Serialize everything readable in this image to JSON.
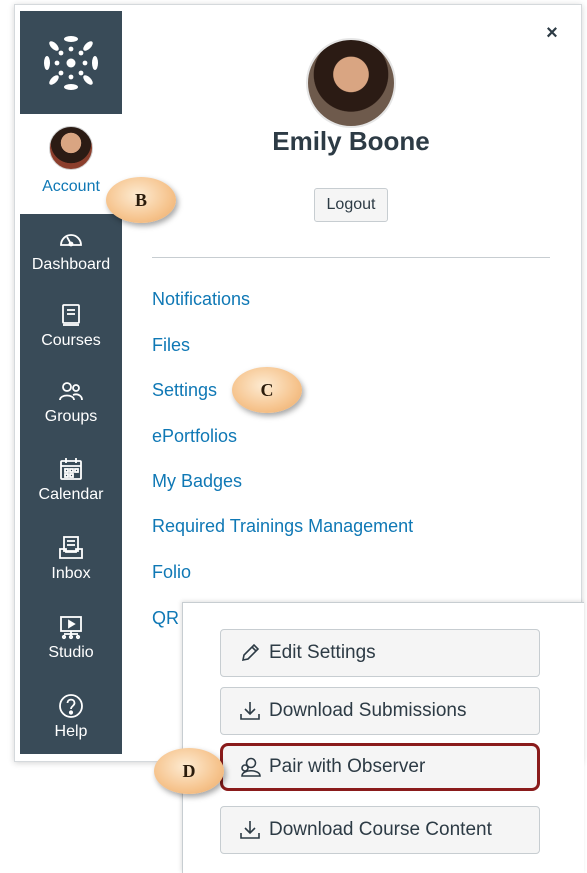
{
  "nav": {
    "account_label": "Account",
    "items": [
      {
        "label": "Dashboard",
        "icon": "dashboard-icon"
      },
      {
        "label": "Courses",
        "icon": "courses-icon"
      },
      {
        "label": "Groups",
        "icon": "groups-icon"
      },
      {
        "label": "Calendar",
        "icon": "calendar-icon"
      },
      {
        "label": "Inbox",
        "icon": "inbox-icon"
      },
      {
        "label": "Studio",
        "icon": "studio-icon"
      },
      {
        "label": "Help",
        "icon": "help-icon"
      }
    ]
  },
  "profile": {
    "close_label": "×",
    "name": "Emily Boone",
    "logout_label": "Logout"
  },
  "menu": {
    "links": [
      "Notifications",
      "Files",
      "Settings",
      "ePortfolios",
      "My Badges",
      "Required Trainings Management",
      "Folio",
      "QR"
    ]
  },
  "callouts": {
    "b": "B",
    "c": "C",
    "d": "D"
  },
  "popup": {
    "buttons": [
      {
        "label": "Edit Settings",
        "icon": "pencil-icon"
      },
      {
        "label": "Download Submissions",
        "icon": "download-icon"
      },
      {
        "label": "Pair with Observer",
        "icon": "observer-icon"
      },
      {
        "label": "Download Course Content",
        "icon": "download-icon"
      }
    ]
  },
  "colors": {
    "nav_bg": "#394b58",
    "link": "#0f78b5",
    "highlight_border": "#8a1b1b",
    "callout": "#f6c48e"
  }
}
